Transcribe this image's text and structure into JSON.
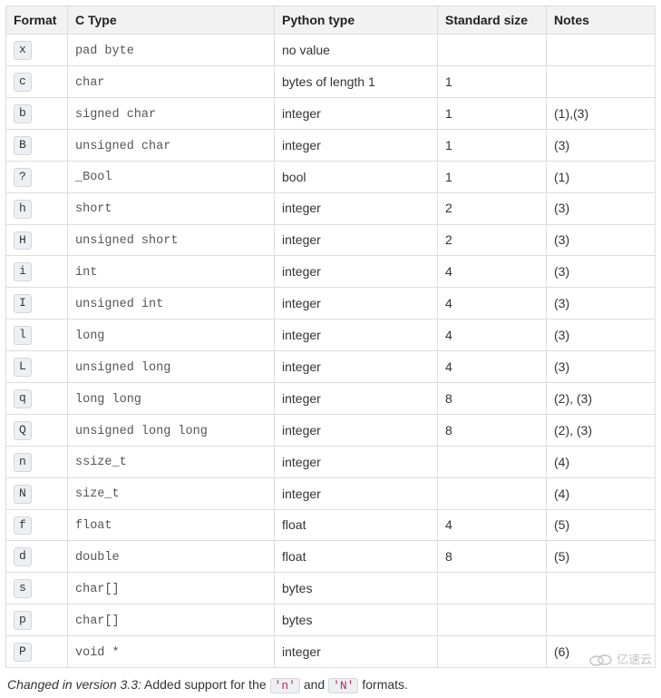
{
  "headers": {
    "format": "Format",
    "ctype": "C Type",
    "pytype": "Python type",
    "size": "Standard size",
    "notes": "Notes"
  },
  "rows": [
    {
      "format": "x",
      "ctype": "pad byte",
      "pytype": "no value",
      "size": "",
      "notes": ""
    },
    {
      "format": "c",
      "ctype": "char",
      "pytype": "bytes of length 1",
      "size": "1",
      "notes": ""
    },
    {
      "format": "b",
      "ctype": "signed char",
      "pytype": "integer",
      "size": "1",
      "notes": "(1),(3)"
    },
    {
      "format": "B",
      "ctype": "unsigned char",
      "pytype": "integer",
      "size": "1",
      "notes": "(3)"
    },
    {
      "format": "?",
      "ctype": "_Bool",
      "pytype": "bool",
      "size": "1",
      "notes": "(1)"
    },
    {
      "format": "h",
      "ctype": "short",
      "pytype": "integer",
      "size": "2",
      "notes": "(3)"
    },
    {
      "format": "H",
      "ctype": "unsigned short",
      "pytype": "integer",
      "size": "2",
      "notes": "(3)"
    },
    {
      "format": "i",
      "ctype": "int",
      "pytype": "integer",
      "size": "4",
      "notes": "(3)"
    },
    {
      "format": "I",
      "ctype": "unsigned int",
      "pytype": "integer",
      "size": "4",
      "notes": "(3)"
    },
    {
      "format": "l",
      "ctype": "long",
      "pytype": "integer",
      "size": "4",
      "notes": "(3)"
    },
    {
      "format": "L",
      "ctype": "unsigned long",
      "pytype": "integer",
      "size": "4",
      "notes": "(3)"
    },
    {
      "format": "q",
      "ctype": "long long",
      "pytype": "integer",
      "size": "8",
      "notes": "(2), (3)"
    },
    {
      "format": "Q",
      "ctype": "unsigned long long",
      "pytype": "integer",
      "size": "8",
      "notes": "(2), (3)"
    },
    {
      "format": "n",
      "ctype": "ssize_t",
      "pytype": "integer",
      "size": "",
      "notes": "(4)"
    },
    {
      "format": "N",
      "ctype": "size_t",
      "pytype": "integer",
      "size": "",
      "notes": "(4)"
    },
    {
      "format": "f",
      "ctype": "float",
      "pytype": "float",
      "size": "4",
      "notes": "(5)"
    },
    {
      "format": "d",
      "ctype": "double",
      "pytype": "float",
      "size": "8",
      "notes": "(5)"
    },
    {
      "format": "s",
      "ctype": "char[]",
      "pytype": "bytes",
      "size": "",
      "notes": ""
    },
    {
      "format": "p",
      "ctype": "char[]",
      "pytype": "bytes",
      "size": "",
      "notes": ""
    },
    {
      "format": "P",
      "ctype": "void *",
      "pytype": "integer",
      "size": "",
      "notes": "(6)"
    }
  ],
  "footnote": {
    "changed_label": "Changed in version 3.3:",
    "pre": " Added support for the ",
    "code_n": "'n'",
    "mid": " and ",
    "code_N_": "'N'",
    "post": " formats."
  },
  "watermark": "亿速云"
}
